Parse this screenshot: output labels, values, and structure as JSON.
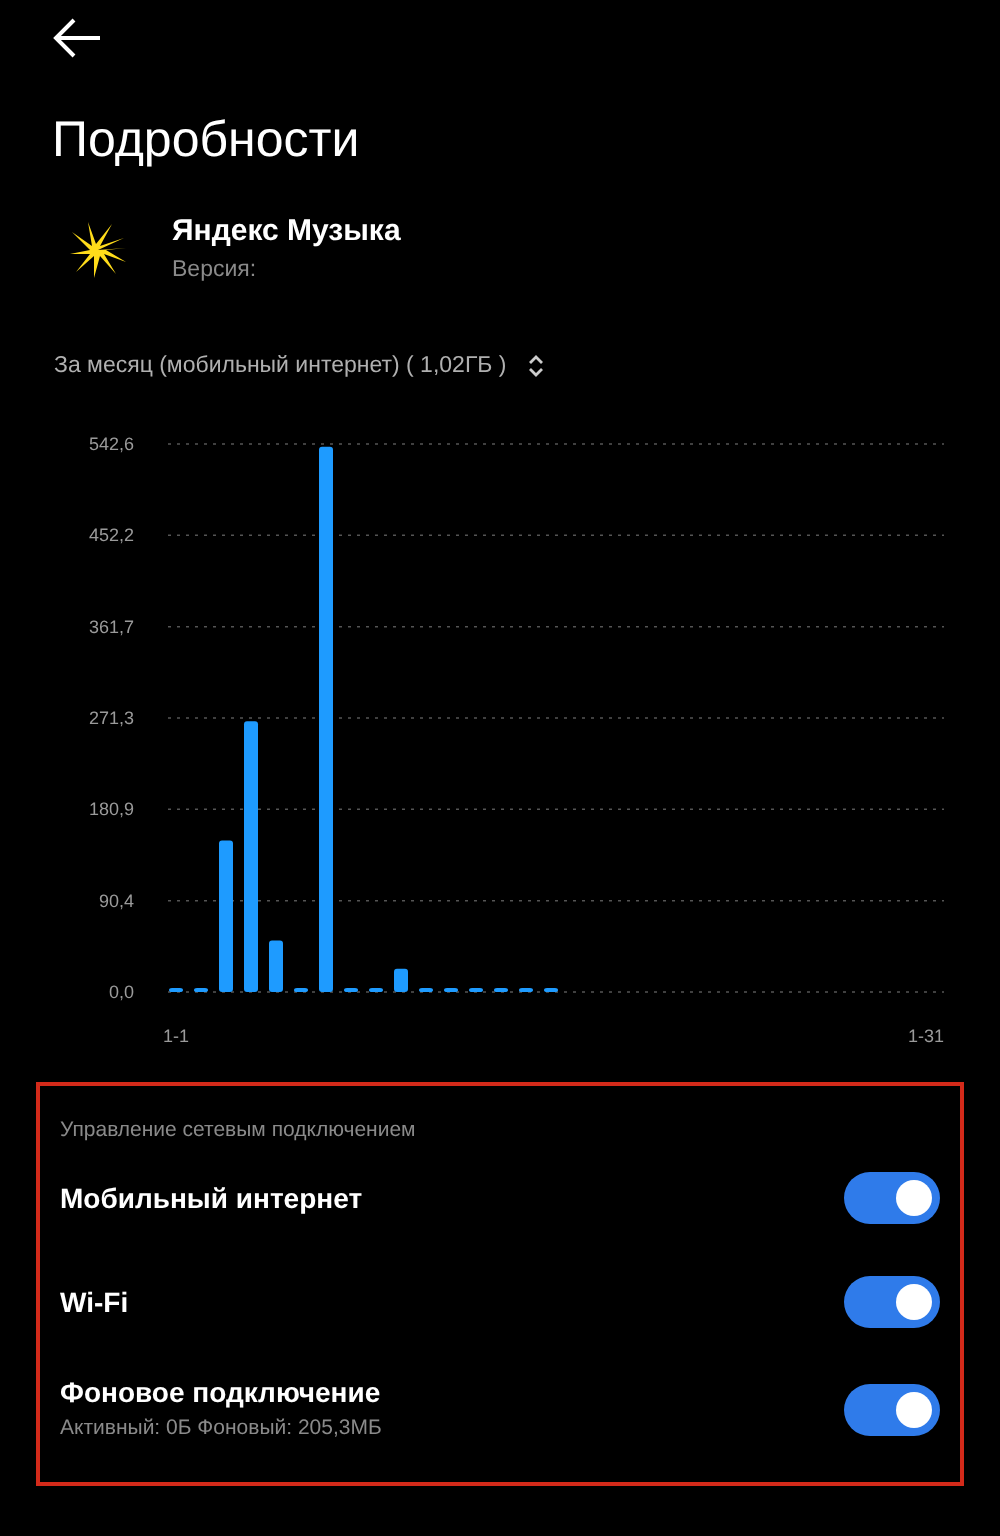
{
  "title": "Подробности",
  "app": {
    "name": "Яндекс Музыка",
    "version_label": "Версия:"
  },
  "period": {
    "label": "За месяц (мобильный интернет) ( 1,02ГБ )"
  },
  "chart_data": {
    "type": "bar",
    "grid": true,
    "categories": [
      "1-1",
      null,
      null,
      null,
      null,
      null,
      null,
      null,
      null,
      null,
      null,
      null,
      null,
      null,
      null,
      null,
      null,
      null,
      null,
      null,
      null,
      null,
      null,
      null,
      null,
      null,
      null,
      null,
      null,
      null,
      "1-31"
    ],
    "series": [
      {
        "color": "#1e9bff",
        "values": [
          0,
          0,
          150,
          268,
          51,
          0,
          540,
          0,
          0,
          23,
          0,
          0,
          0,
          0,
          0,
          0,
          null,
          null,
          null,
          null,
          null,
          null,
          null,
          null,
          null,
          null,
          null,
          null,
          null,
          null,
          null
        ]
      }
    ],
    "ylim": [
      0,
      542.6
    ],
    "yticks": [
      {
        "value": 0,
        "label": "0,0"
      },
      {
        "value": 90.4,
        "label": "90,4"
      },
      {
        "value": 180.9,
        "label": "180,9"
      },
      {
        "value": 271.3,
        "label": "271,3"
      },
      {
        "value": 361.7,
        "label": "361,7"
      },
      {
        "value": 452.2,
        "label": "452,2"
      },
      {
        "value": 542.6,
        "label": "542,6"
      }
    ]
  },
  "network": {
    "heading": "Управление сетевым подключением",
    "items": [
      {
        "label": "Мобильный интернет",
        "on": true
      },
      {
        "label": "Wi-Fi",
        "on": true
      },
      {
        "label": "Фоновое подключение",
        "detail": "Активный: 0Б  Фоновый: 205,3МБ",
        "on": true
      }
    ]
  }
}
